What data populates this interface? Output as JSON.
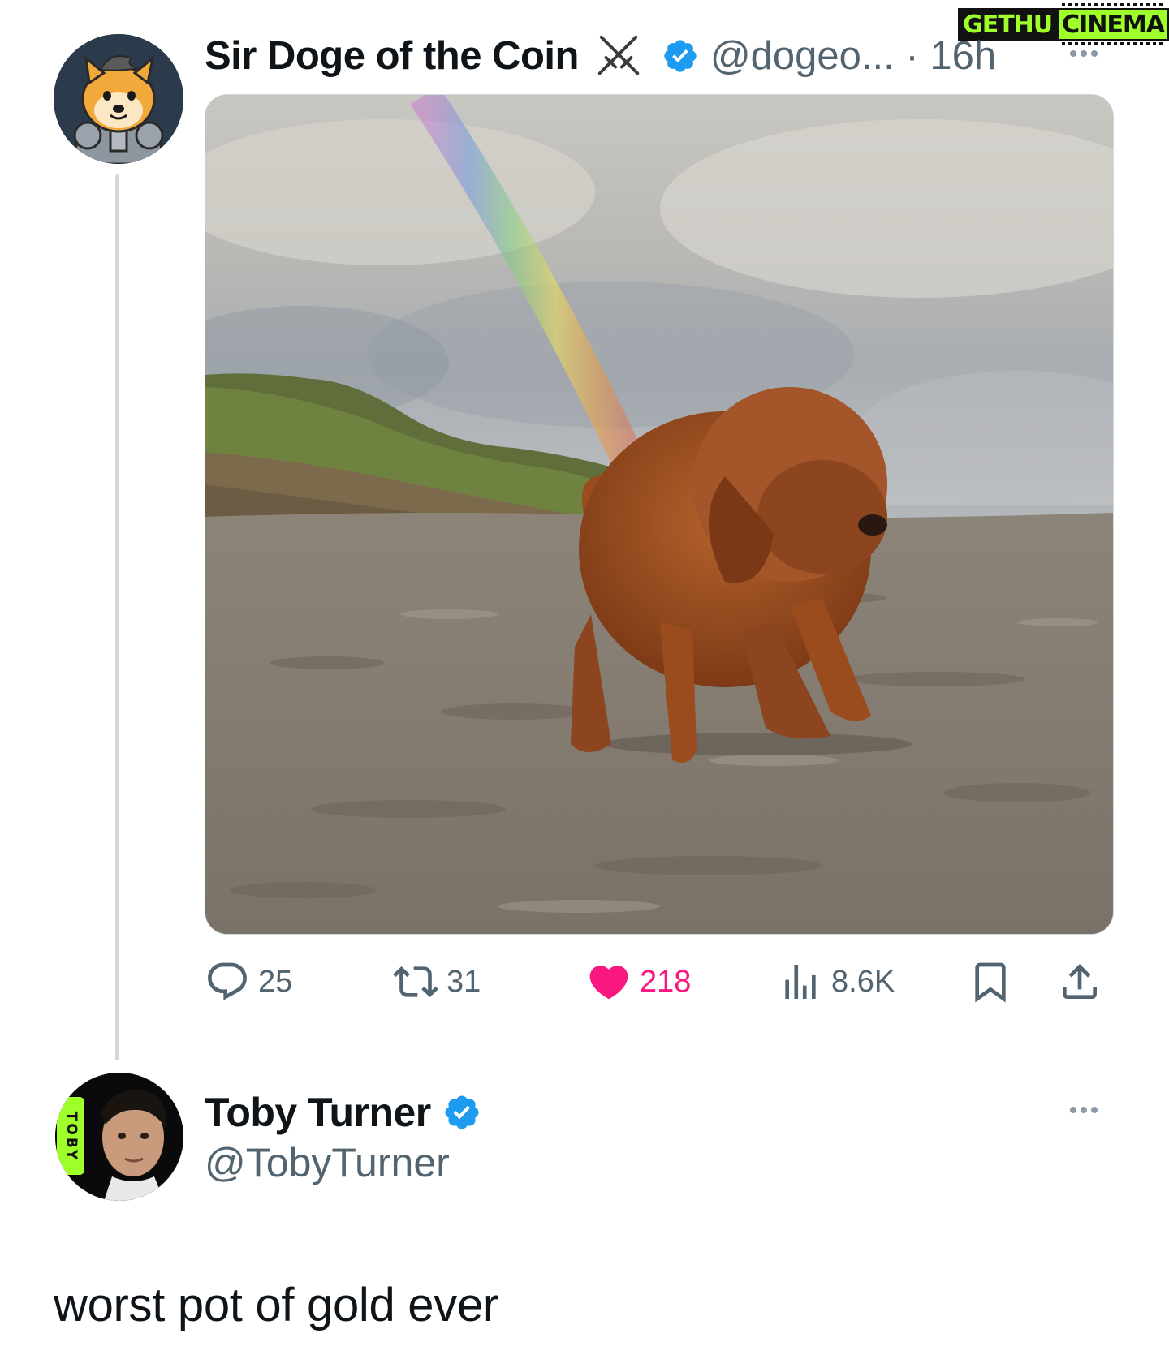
{
  "watermark": {
    "left": "GETHU",
    "right": "CINEMA"
  },
  "tweet": {
    "author": {
      "display_name": "Sir Doge of the Coin",
      "handle_time": "@dogeo... · 16h"
    },
    "media_icon": "swords-icon",
    "stats": {
      "replies": "25",
      "retweets": "31",
      "likes": "218",
      "views": "8.6K"
    }
  },
  "reply": {
    "author": {
      "display_name": "Toby Turner",
      "handle": "@TobyTurner",
      "avatar_badge": "TOBY"
    },
    "text": "worst pot of gold ever"
  },
  "colors": {
    "verified": "#1d9bf0",
    "like": "#f91880",
    "muted": "#536471",
    "thread_line": "#cfd9de"
  }
}
